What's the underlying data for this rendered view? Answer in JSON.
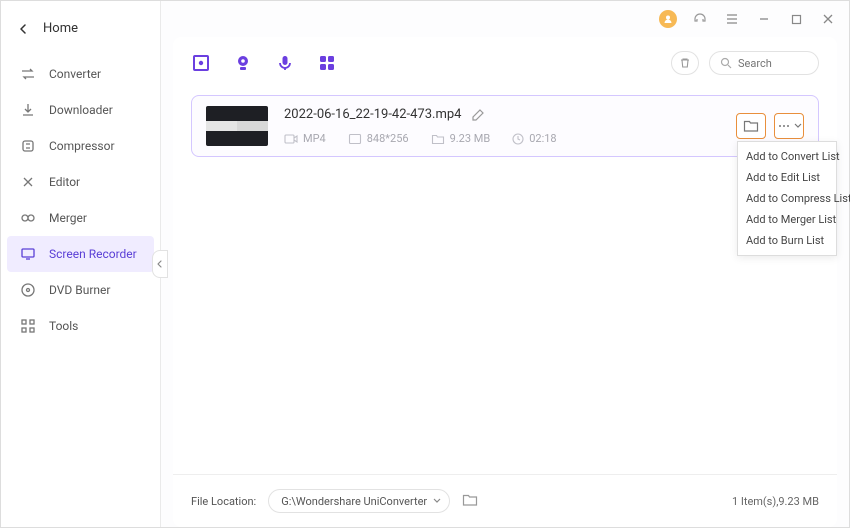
{
  "sidebar": {
    "title": "Home",
    "items": [
      {
        "label": "Converter"
      },
      {
        "label": "Downloader"
      },
      {
        "label": "Compressor"
      },
      {
        "label": "Editor"
      },
      {
        "label": "Merger"
      },
      {
        "label": "Screen Recorder"
      },
      {
        "label": "DVD Burner"
      },
      {
        "label": "Tools"
      }
    ]
  },
  "search": {
    "placeholder": "Search"
  },
  "file": {
    "name": "2022-06-16_22-19-42-473.mp4",
    "format": "MP4",
    "resolution": "848*256",
    "size": "9.23 MB",
    "duration": "02:18"
  },
  "dropdown": {
    "items": [
      "Add to Convert List",
      "Add to Edit List",
      "Add to Compress List",
      "Add to Merger List",
      "Add to Burn List"
    ]
  },
  "footer": {
    "label": "File Location:",
    "path": "G:\\Wondershare UniConverter",
    "summary": "1 Item(s),9.23 MB"
  }
}
